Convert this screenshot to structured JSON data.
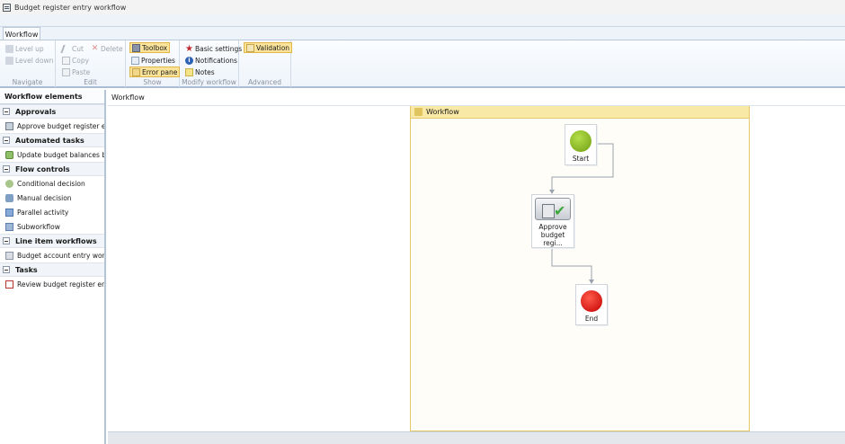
{
  "window": {
    "title": "Budget register entry workflow"
  },
  "tabs": [
    {
      "label": "Workflow"
    }
  ],
  "ribbon": {
    "navigate": {
      "label": "Navigate",
      "level_up": "Level up",
      "level_down": "Level down"
    },
    "edit": {
      "label": "Edit",
      "cut": "Cut",
      "delete": "Delete",
      "copy": "Copy",
      "paste": "Paste"
    },
    "show": {
      "label": "Show",
      "toolbox": "Toolbox",
      "properties": "Properties",
      "error_pane": "Error pane"
    },
    "modify": {
      "label": "Modify workflow",
      "basic_settings": "Basic settings",
      "notifications": "Notifications",
      "notes": "Notes"
    },
    "advanced": {
      "label": "Advanced",
      "validation": "Validation"
    }
  },
  "elements_pane": {
    "title": "Workflow elements",
    "categories": [
      {
        "name": "Approvals",
        "items": [
          "Approve budget register entry"
        ]
      },
      {
        "name": "Automated tasks",
        "items": [
          "Update budget balances budget"
        ]
      },
      {
        "name": "Flow controls",
        "items": [
          "Conditional decision",
          "Manual decision",
          "Parallel activity",
          "Subworkflow"
        ]
      },
      {
        "name": "Line item workflows",
        "items": [
          "Budget account entry workflow"
        ]
      },
      {
        "name": "Tasks",
        "items": [
          "Review budget register entry"
        ]
      }
    ]
  },
  "canvas": {
    "header": "Workflow",
    "container_title": "Workflow",
    "nodes": {
      "start": "Start",
      "approve": "Approve budget regi...",
      "end": "End"
    }
  },
  "colors": {
    "start": "#8cc21f",
    "end": "#e00000",
    "active_button": "#fbe49a",
    "container_header": "#f9e9a6"
  }
}
